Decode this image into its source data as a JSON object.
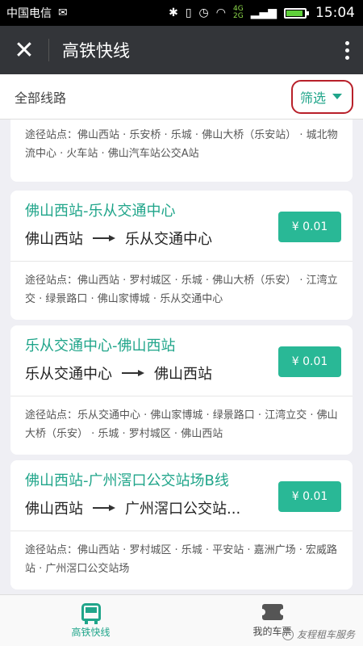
{
  "status_bar": {
    "carrier": "中国电信",
    "network_top": "4G",
    "network_bottom": "2G",
    "time": "15:04",
    "battery_level": 0.9
  },
  "app_bar": {
    "title": "高铁快线",
    "close_icon": "close-icon",
    "more_icon": "more-vert-icon"
  },
  "filter_bar": {
    "all_routes_label": "全部线路",
    "filter_label": "筛选"
  },
  "partial_card": {
    "stations": "途径站点：佛山西站 · 乐安桥 · 乐城 · 佛山大桥（乐安站） · 城北物流中心 · 火车站 · 佛山汽车站公交A站"
  },
  "routes": [
    {
      "title": "佛山西站-乐从交通中心",
      "from": "佛山西站",
      "to": "乐从交通中心",
      "price": "¥ 0.01",
      "stations": "途径站点：佛山西站 · 罗村城区 · 乐城 · 佛山大桥（乐安） · 江湾立交 · 绿景路口 · 佛山家博城 · 乐从交通中心"
    },
    {
      "title": "乐从交通中心-佛山西站",
      "from": "乐从交通中心",
      "to": "佛山西站",
      "price": "¥ 0.01",
      "stations": "途径站点：乐从交通中心 · 佛山家博城 · 绿景路口 · 江湾立交 · 佛山大桥（乐安） · 乐城 · 罗村城区 · 佛山西站"
    },
    {
      "title": "佛山西站-广州滘口公交站场B线",
      "from": "佛山西站",
      "to": "广州滘口公交站...",
      "price": "¥ 0.01",
      "stations": "途径站点：佛山西站 · 罗村城区 · 乐城 · 平安站 · 嘉洲广场 · 宏威路站 · 广州滘口公交站场"
    }
  ],
  "bottom_nav": {
    "items": [
      {
        "label": "高铁快线",
        "icon": "bus-icon",
        "active": true
      },
      {
        "label": "我的车票",
        "icon": "ticket-icon",
        "active": false
      }
    ],
    "watermark": "友程租车服务"
  },
  "colors": {
    "accent": "#20a58a",
    "price_button": "#29b896",
    "app_bar": "#333539",
    "filter_highlight": "#b8202a"
  }
}
